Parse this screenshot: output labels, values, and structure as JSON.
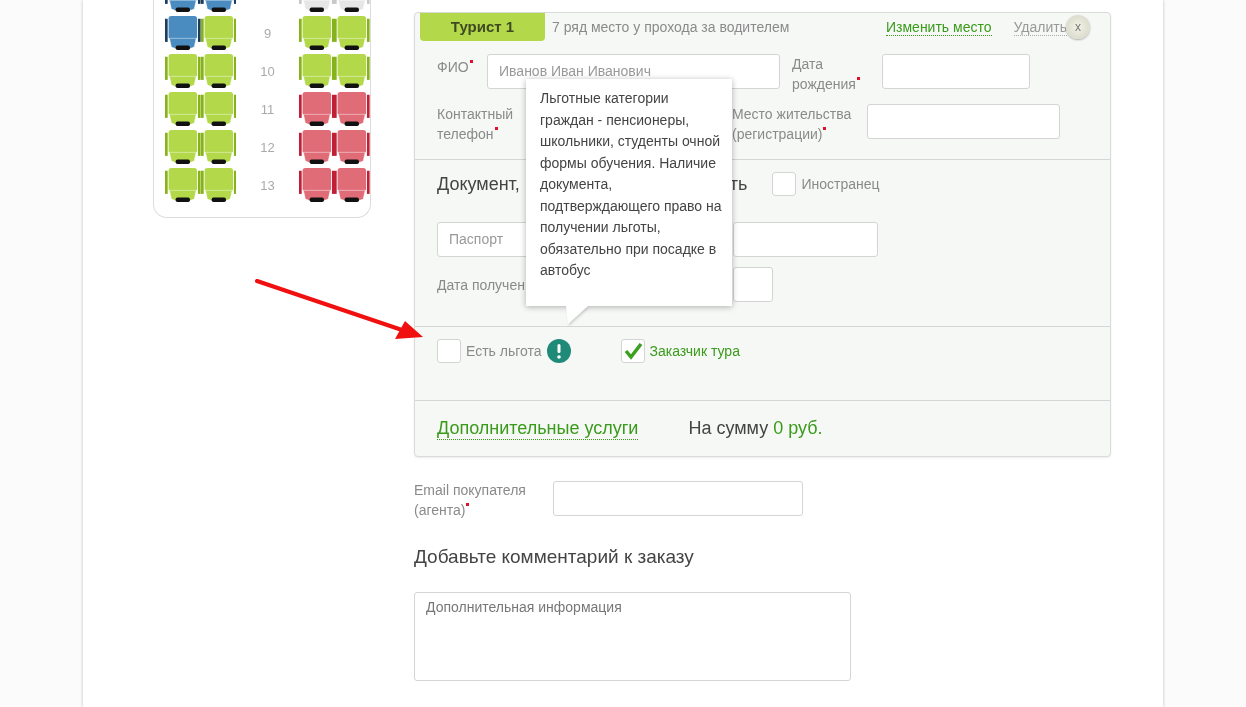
{
  "seat_map": {
    "rows": [
      {
        "seats": [
          {
            "kind": "selected"
          },
          {
            "kind": "selected"
          },
          {
            "kind": "unavailable"
          },
          {
            "kind": "unavailable"
          }
        ]
      },
      {
        "number": "9",
        "seats": [
          {
            "kind": "selected"
          },
          {
            "kind": "free"
          },
          {
            "kind": "free"
          },
          {
            "kind": "free"
          }
        ]
      },
      {
        "number": "10",
        "seats": [
          {
            "kind": "free"
          },
          {
            "kind": "free"
          },
          {
            "kind": "free"
          },
          {
            "kind": "free"
          }
        ]
      },
      {
        "number": "11",
        "seats": [
          {
            "kind": "free"
          },
          {
            "kind": "free"
          },
          {
            "kind": "taken"
          },
          {
            "kind": "taken"
          }
        ]
      },
      {
        "number": "12",
        "seats": [
          {
            "kind": "free"
          },
          {
            "kind": "free"
          },
          {
            "kind": "taken"
          },
          {
            "kind": "taken"
          }
        ]
      },
      {
        "number": "13",
        "seats": [
          {
            "kind": "free"
          },
          {
            "kind": "free"
          },
          {
            "kind": "taken"
          },
          {
            "kind": "taken"
          }
        ]
      }
    ]
  },
  "tourist": {
    "tab": "Турист 1",
    "seat_description": "7 ряд место у прохода за водителем",
    "change_seat_link": "Изменить место",
    "delete_link": "Удалить",
    "close_button": "x",
    "full_name": {
      "label": "ФИО",
      "required": true,
      "value": "Иванов Иван Иванович"
    },
    "birth_date": {
      "label": "Дата рождения",
      "required": true
    },
    "phone": {
      "label": "Контактный телефон",
      "required": true
    },
    "residence": {
      "label": "Место жительства (регистрации)",
      "required": true
    },
    "document": {
      "heading_start": "Документ,",
      "heading_end": "ть",
      "foreigner": {
        "label": "Иностранец",
        "checked": false
      },
      "type_field": {
        "value": "Паспорт"
      },
      "issue_date_label": "Дата получен"
    },
    "options": [
      {
        "label": "Есть льгота",
        "checked": false,
        "info": true
      },
      {
        "label": "Заказчик тура",
        "checked": true,
        "info": false
      }
    ],
    "extra_services_link": "Дополнительные услуги",
    "sum_label": "На сумму",
    "sum_value": "0 руб."
  },
  "tooltip": {
    "text": "Льготные категории граждан - пенсионеры, школьники, студенты очной формы обучения. Наличие документа, подтверждающего право на получении льготы, обязательно при посадке в автобус"
  },
  "email": {
    "label": "Email покупателя (агента)",
    "required": true
  },
  "comment": {
    "heading": "Добавьте комментарий к заказу",
    "placeholder": "Дополнительная информация"
  }
}
